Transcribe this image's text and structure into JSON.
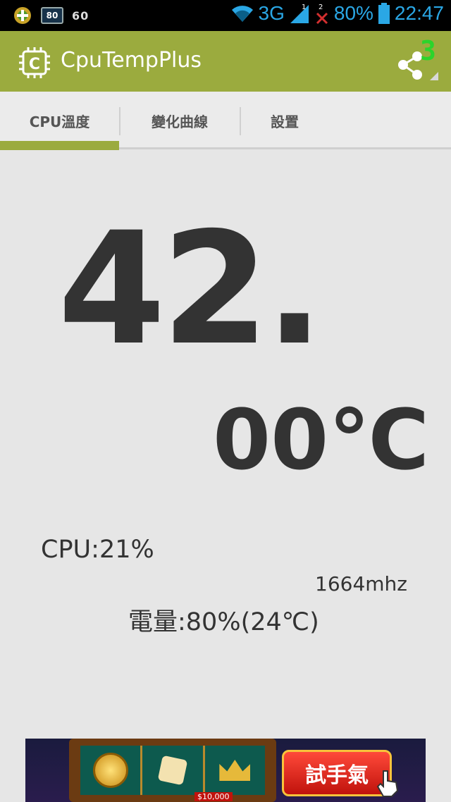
{
  "status_bar": {
    "badge_text": "80",
    "left_text": "60",
    "network": "3G",
    "sim1_label": "1",
    "sim2_label": "2",
    "battery": "80%",
    "time": "22:47",
    "icon_color": "#2aa7e5"
  },
  "action_bar": {
    "title": "CpuTempPlus",
    "share_badge": "3",
    "color": "#9bab3e"
  },
  "tabs": [
    {
      "label": "CPU溫度",
      "selected": true
    },
    {
      "label": "變化曲線",
      "selected": false
    },
    {
      "label": "設置",
      "selected": false
    }
  ],
  "temperature": {
    "integer_part": "42.",
    "decimal_part": "00℃"
  },
  "stats": {
    "cpu_usage": "CPU:21%",
    "cpu_freq": "1664mhz",
    "battery": "電量:80%(24℃)"
  },
  "ad": {
    "button_label": "試手氣",
    "prize_text": "$10,000"
  }
}
